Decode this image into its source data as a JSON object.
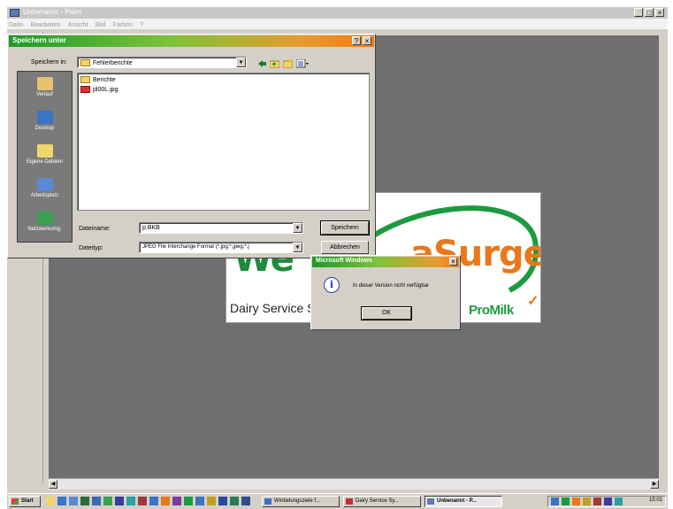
{
  "app": {
    "title": "Unbenannt - Paint",
    "menu": [
      "Datei",
      "Bearbeiten",
      "Ansicht",
      "Bild",
      "Farben",
      "?"
    ],
    "window_buttons": {
      "minimize": "_",
      "maximize": "□",
      "close": "×"
    }
  },
  "artwork": {
    "headline_left": "We",
    "headline_right": "aSurge",
    "tagline": "Dairy Service S",
    "brand": "ProMilk",
    "brand_mark": "✓",
    "colors": {
      "green": "#1d9a3f",
      "orange": "#e9781c"
    }
  },
  "save_dialog": {
    "title": "Speichern unter",
    "help_button": "?",
    "close_button": "×",
    "look_in_label": "Speichern in:",
    "look_in_value": "Fehlerberichte",
    "places": [
      {
        "label": "Verlauf",
        "icon": "history-icon"
      },
      {
        "label": "Desktop",
        "icon": "desktop-icon"
      },
      {
        "label": "Eigene Dateien",
        "icon": "my-documents-icon"
      },
      {
        "label": "Arbeitsplatz",
        "icon": "my-computer-icon"
      },
      {
        "label": "Netzwerkumg.",
        "icon": "network-icon"
      }
    ],
    "files": [
      {
        "name": "Berichte",
        "type": "folder"
      },
      {
        "name": "pl00L.jpg",
        "type": "jpg"
      }
    ],
    "filename_label": "Dateiname:",
    "filename_value": "p.BKB",
    "filetype_label": "Dateityp:",
    "filetype_value": "JPEG File Interchange Format (*.jpg;*.jpeg;*.j",
    "save_button": "Speichern",
    "cancel_button": "Abbrechen"
  },
  "message_box": {
    "title": "Microsoft Windows",
    "close_button": "×",
    "text": "In dieser Version nicht verfügbar",
    "ok_button": "OK"
  },
  "taskbar": {
    "start": "Start",
    "tasks": [
      {
        "label": "Winbelungsziele f...",
        "active": false
      },
      {
        "label": "Dairy Service Sy...",
        "active": false
      },
      {
        "label": "Unbenannt - P...",
        "active": true
      }
    ],
    "clock": "15:01"
  }
}
